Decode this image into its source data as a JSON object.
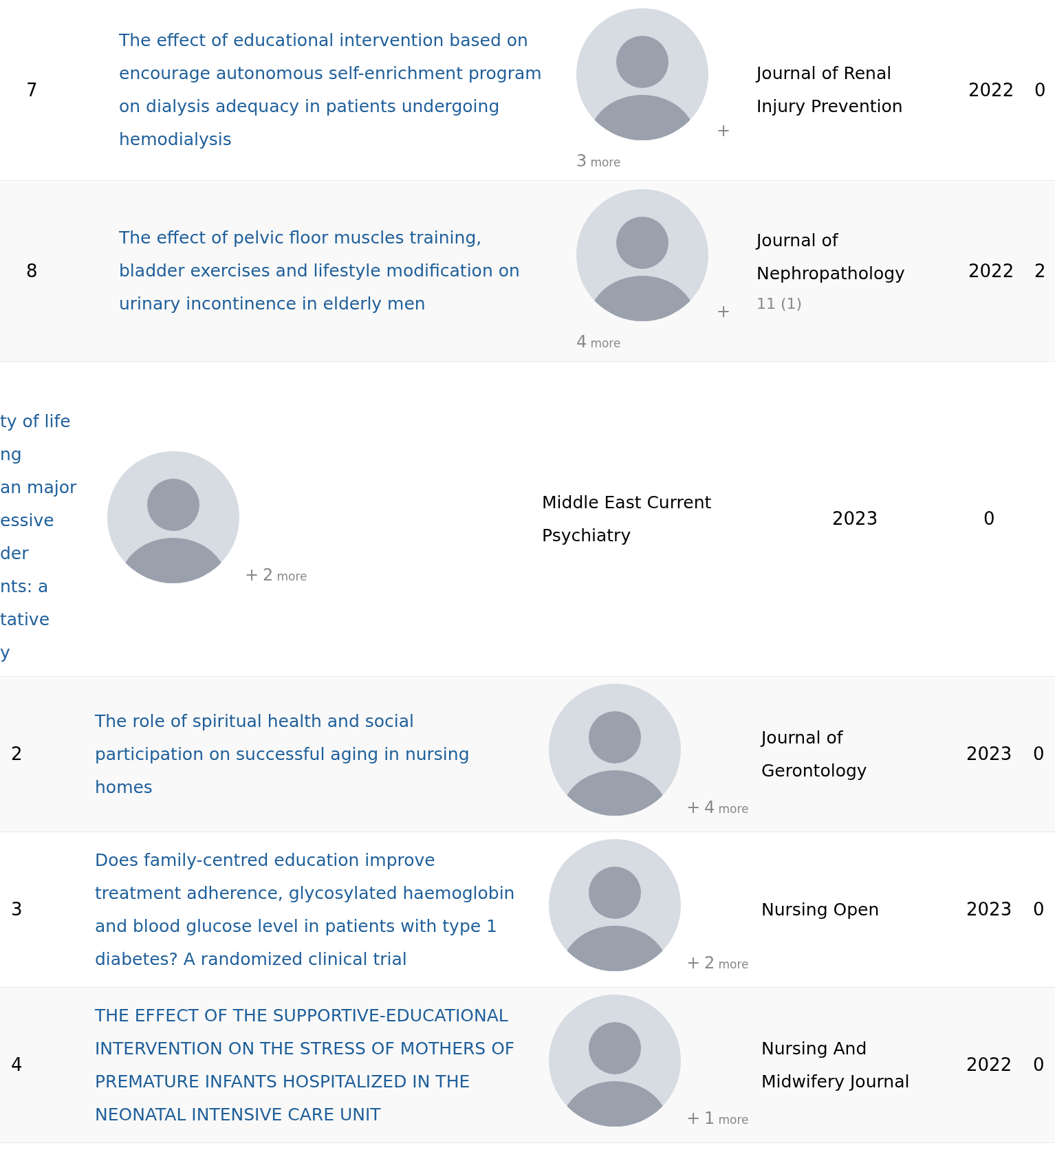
{
  "sections": [
    {
      "kind": "wrapped",
      "rows": [
        {
          "number": "7",
          "title": "The effect of educational intervention based on encourage autonomous self-enrichment program on dialysis adequacy in patients undergoing hemodialysis",
          "plus": "+",
          "more_count": "3",
          "more_label": "more",
          "journal": "Journal of Renal Injury Prevention",
          "year": "2022",
          "citations": "0"
        },
        {
          "number": "8",
          "title": "The effect of pelvic floor muscles training, bladder exercises and lifestyle modification on urinary incontinence in elderly men",
          "plus": "+",
          "more_count": "4",
          "more_label": "more",
          "journal": "Journal of Nephropathology",
          "journal_extra": "11 (1)",
          "year": "2022",
          "citations": "2"
        }
      ]
    },
    {
      "kind": "cut",
      "rows": [
        {
          "title": "ty of life\nng\nan major\nessive\nder\nnts: a\ntative\ny",
          "plus": "+",
          "more_count": "2",
          "more_label": "more",
          "journal": "Middle East Current Psychiatry",
          "year": "2023",
          "citations": "0"
        }
      ]
    },
    {
      "kind": "inline",
      "rows": [
        {
          "number": "2",
          "title": "The role of spiritual health and social participation on successful aging in nursing homes",
          "plus": "+",
          "more_count": "4",
          "more_label": "more",
          "journal": "Journal of Gerontology",
          "year": "2023",
          "citations": "0"
        },
        {
          "number": "3",
          "title": "Does family-centred education improve treatment adherence, glycosylated haemoglobin and blood glucose level in patients with type 1 diabetes? A randomized clinical trial",
          "plus": "+",
          "more_count": "2",
          "more_label": "more",
          "journal": "Nursing Open",
          "year": "2023",
          "citations": "0"
        },
        {
          "number": "4",
          "title": "THE EFFECT OF THE SUPPORTIVE-EDUCATIONAL INTERVENTION ON THE STRESS OF MOTHERS OF PREMATURE INFANTS HOSPITALIZED IN THE NEONATAL INTENSIVE CARE UNIT",
          "plus": "+",
          "more_count": "1",
          "more_label": "more",
          "journal": "Nursing And Midwifery Journal",
          "year": "2022",
          "citations": "0"
        }
      ]
    }
  ]
}
